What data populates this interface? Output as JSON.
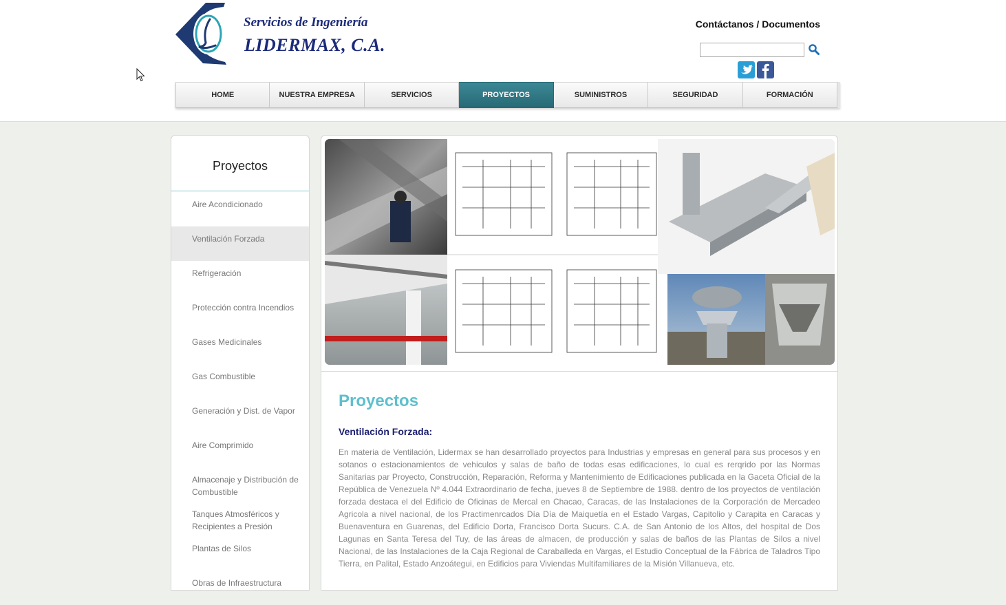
{
  "brand": {
    "line1": "Servicios de Ingeniería",
    "line2": "LIDERMAX, C.A.",
    "logo_letter": "L",
    "colors": {
      "navy": "#1b2a7a",
      "teal": "#2aa6b4"
    }
  },
  "header": {
    "links_text": "Contáctanos / Documentos",
    "search": {
      "value": "",
      "icon": "search-icon"
    },
    "social": [
      {
        "name": "twitter",
        "icon": "twitter-icon"
      },
      {
        "name": "facebook",
        "icon": "facebook-icon"
      }
    ]
  },
  "nav": {
    "items": [
      {
        "label": "HOME"
      },
      {
        "label": "NUESTRA EMPRESA"
      },
      {
        "label": "SERVICIOS"
      },
      {
        "label": "PROYECTOS",
        "active": true
      },
      {
        "label": "SUMINISTROS"
      },
      {
        "label": "SEGURIDAD"
      },
      {
        "label": "FORMACIÓN"
      }
    ],
    "active_color": "#2f7a86"
  },
  "sidebar": {
    "title": "Proyectos",
    "items": [
      {
        "label": "Aire Acondicionado"
      },
      {
        "label": "Ventilación Forzada",
        "selected": true
      },
      {
        "label": "Refrigeración"
      },
      {
        "label": "Protección contra Incendios"
      },
      {
        "label": "Gases Medicinales"
      },
      {
        "label": "Gas Combustible"
      },
      {
        "label": "Generación y Dist. de Vapor"
      },
      {
        "label": "Aire Comprimido"
      },
      {
        "label": "Almacenaje y Distribución de Combustible"
      },
      {
        "label": "Tanques Atmosféricos y Recipientes a Presión"
      },
      {
        "label": "Plantas de Silos"
      },
      {
        "label": "Obras de Infraestructura"
      }
    ]
  },
  "main": {
    "title": "Proyectos",
    "subtitle": "Ventilación Forzada:",
    "body": "En materia de Ventilación, Lidermax se han desarrollado proyectos para Industrias y empresas en general para sus procesos y en sotanos o estacionamientos de vehiculos y salas de baño de todas esas edificaciones, lo cual es rerqrido por las Normas Sanitarias par Proyecto, Construcción, Reparación, Reforma y Mantenimiento de Edificaciones publicada en la Gaceta Oficial de la República de Venezuela Nº 4.044 Extraordinario de fecha, jueves 8 de Septiembre de 1988. dentro de los proyectos de ventilación forzada destaca el del Edificio de Oficinas de Mercal en Chacao, Caracas, de las Instalaciones de la Corporación de Mercadeo Agricola a nivel nacional, de los Practimenrcados Día Día de Maiquetía en el Estado Vargas, Capitolio y Carapita en Caracas y Buenaventura en Guarenas, del Edificio Dorta, Francisco Dorta Sucurs. C.A. de San Antonio de los Altos, del hospital de Dos Lagunas en Santa Teresa del Tuy, de las áreas de almacen, de producción y salas de baños de las Plantas de Silos a nivel Nacional, de las Instalaciones de la Caja Regional de Caraballeda en Vargas, el Estudio Conceptual de la Fábrica de Taladros Tipo Tierra, en Palital, Estado Anzoátegui, en Edificios para Viviendas Multifamiliares de la Misión Villanueva, etc.",
    "colors": {
      "title": "#5ebfcc",
      "subtitle": "#1b1f6e"
    }
  }
}
